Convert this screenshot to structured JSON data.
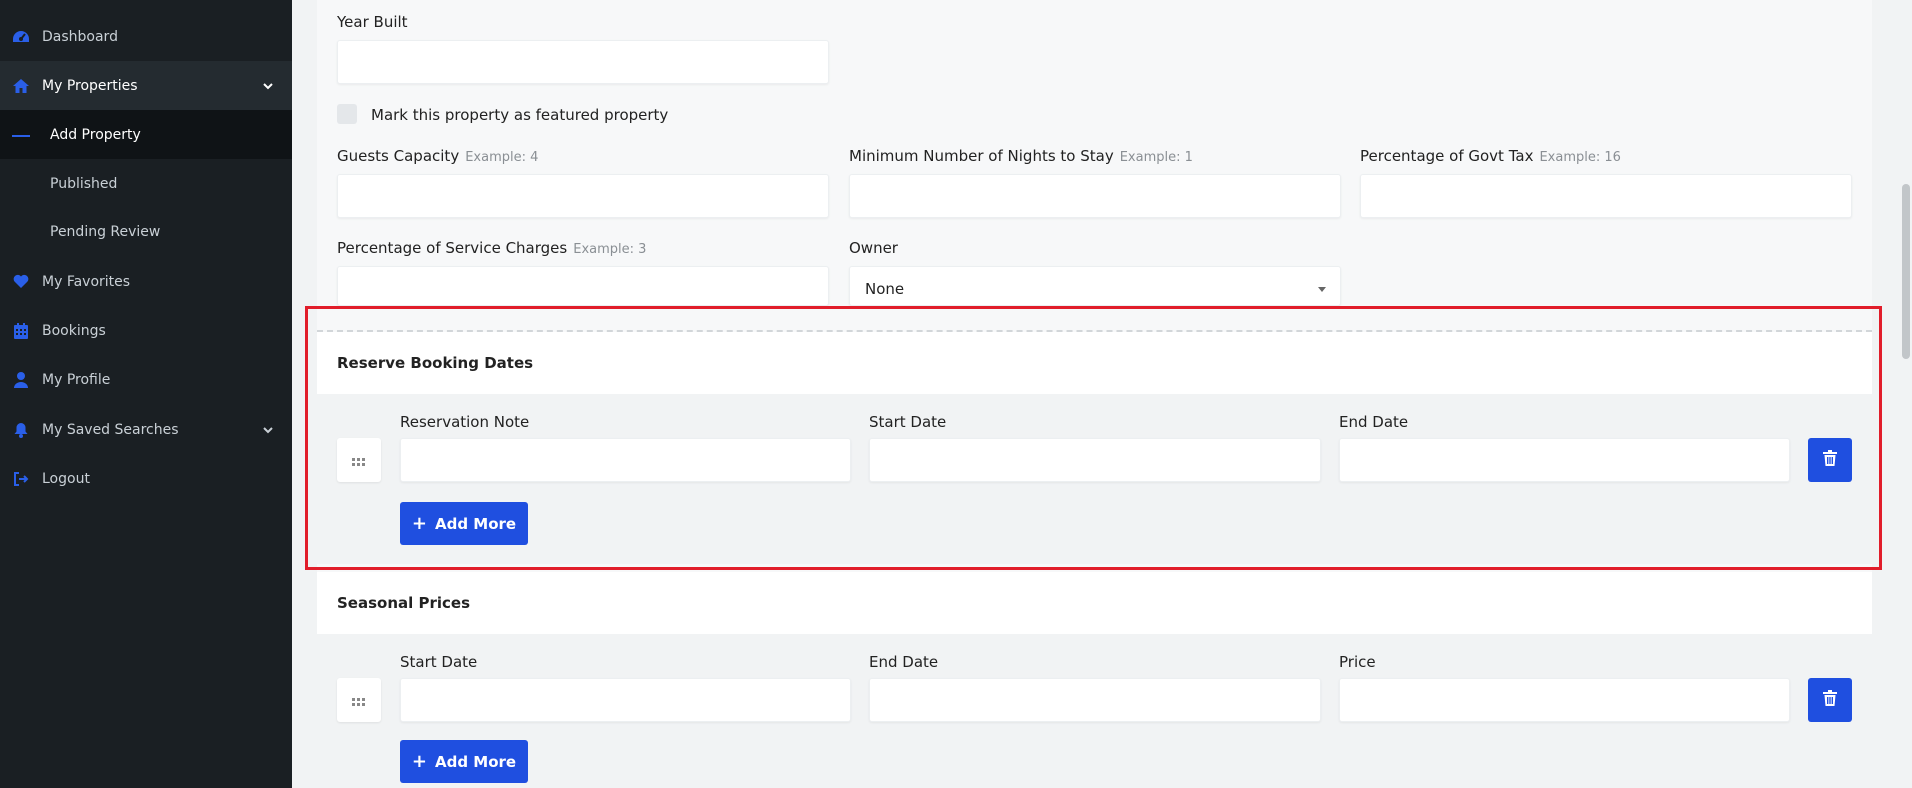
{
  "sidebar": {
    "items": [
      {
        "label": "Dashboard",
        "icon": "dashboard-icon"
      },
      {
        "label": "My Properties",
        "icon": "home-icon"
      },
      {
        "label": "My Favorites",
        "icon": "heart-icon"
      },
      {
        "label": "Bookings",
        "icon": "calendar-icon"
      },
      {
        "label": "My Profile",
        "icon": "user-icon"
      },
      {
        "label": "My Saved Searches",
        "icon": "bell-icon"
      },
      {
        "label": "Logout",
        "icon": "logout-icon"
      }
    ],
    "subitems": [
      {
        "label": "Add Property"
      },
      {
        "label": "Published"
      },
      {
        "label": "Pending Review"
      }
    ]
  },
  "form": {
    "year_built": {
      "label": "Year Built",
      "value": ""
    },
    "featured": {
      "label": "Mark this property as featured property",
      "checked": false
    },
    "guests": {
      "label": "Guests Capacity",
      "hint": "Example: 4",
      "value": ""
    },
    "min_nights": {
      "label": "Minimum Number of Nights to Stay",
      "hint": "Example: 1",
      "value": ""
    },
    "govt_tax": {
      "label": "Percentage of Govt Tax",
      "hint": "Example: 16",
      "value": ""
    },
    "service_charges": {
      "label": "Percentage of Service Charges",
      "hint": "Example: 3",
      "value": ""
    },
    "owner": {
      "label": "Owner",
      "value": "None"
    }
  },
  "reserve": {
    "title": "Reserve Booking Dates",
    "note_label": "Reservation Note",
    "start_label": "Start Date",
    "end_label": "End Date",
    "add_label": "Add More"
  },
  "seasonal": {
    "title": "Seasonal Prices",
    "start_label": "Start Date",
    "end_label": "End Date",
    "price_label": "Price",
    "add_label": "Add More"
  },
  "colors": {
    "sidebar_bg": "#1a1f23",
    "accent": "#1f4fe0",
    "highlight": "#e11d2a"
  }
}
